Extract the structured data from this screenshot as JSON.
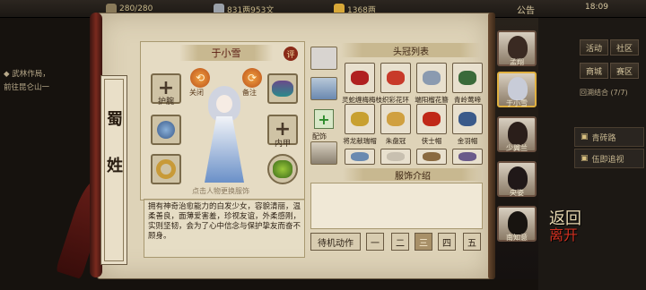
{
  "topbar": {
    "stamina": "280/280",
    "silver": "831两953文",
    "gold": "1368两",
    "notice": "公告",
    "time": "18:09"
  },
  "quest": {
    "line1": "◆ 武林作局，",
    "line2": "前往昆仑山一"
  },
  "right_menu": {
    "activity": "活动",
    "community": "社区",
    "shop": "商城",
    "mail": "赛区",
    "round_label": "回溯结合 (7/7)",
    "link1": "青砖路",
    "link2": "伍即追视"
  },
  "banner": {
    "chars": [
      "蜀",
      "",
      "姓"
    ]
  },
  "character": {
    "name": "于小雪",
    "rate": "评",
    "slot_wrist": "护腕",
    "slot_armor": "内甲",
    "arrow_left": "关闭",
    "arrow_right": "备注",
    "hint": "点击人物更换服饰",
    "description": "拥有神奇治愈能力的白发少女，容貌清丽，温柔善良，面薄爱害羞，珍视友谊，外柔感刚，实则坚韧，会为了心中信念与保护挚友而奋不顾身。"
  },
  "accessory": {
    "label": "配饰"
  },
  "headwear": {
    "title": "头冠列表",
    "items": [
      {
        "label": "灵蛇缠梅",
        "color": "#b02020"
      },
      {
        "label": "梅枝",
        "color": "#c83a2a"
      },
      {
        "label": "织彩花环",
        "color": "#8a9ab0"
      },
      {
        "label": "端阳榴花簪",
        "color": "#3a6a3a"
      },
      {
        "label": "青岭莺啼",
        "color": "#c8a030"
      },
      {
        "label": "将龙献瑞帽",
        "color": "#d0a040"
      },
      {
        "label": "朱盘冠",
        "color": "#c02818"
      },
      {
        "label": "侠士帽",
        "color": "#3a5a8a"
      },
      {
        "label": "金羽帽",
        "color": "#c8a838"
      }
    ],
    "row3": [
      "#6a8ab0",
      "#c8c0b0",
      "#8a6a40",
      "#6a5a8a"
    ]
  },
  "intro": {
    "title": "服饰介绍",
    "text": ""
  },
  "actions": {
    "idle": "待机动作",
    "nums": [
      "一",
      "二",
      "三",
      "四",
      "五"
    ],
    "active_index": 2
  },
  "portraits": [
    {
      "label": "孟翔",
      "hair": "#3a2a22"
    },
    {
      "label": "于小雪",
      "hair": "#c8ccd8"
    },
    {
      "label": "少翼兰",
      "hair": "#2a1e1a"
    },
    {
      "label": "央姿",
      "hair": "#201818"
    },
    {
      "label": "南知意",
      "hair": "#181410"
    }
  ],
  "back": {
    "line1": "返回",
    "line2": "离开"
  }
}
